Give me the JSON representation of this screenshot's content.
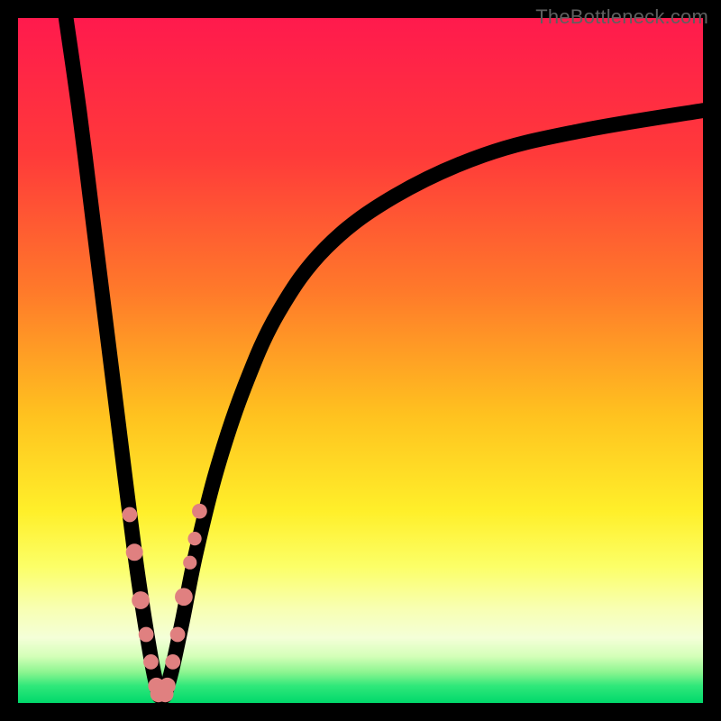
{
  "watermark": "TheBottleneck.com",
  "chart_data": {
    "type": "line",
    "title": "",
    "xlabel": "",
    "ylabel": "",
    "xlim": [
      0,
      100
    ],
    "ylim": [
      0,
      100
    ],
    "gradient_stops": [
      {
        "offset": 0.0,
        "color": "#ff1a4d"
      },
      {
        "offset": 0.2,
        "color": "#ff3a3a"
      },
      {
        "offset": 0.4,
        "color": "#ff7a2a"
      },
      {
        "offset": 0.58,
        "color": "#ffc21f"
      },
      {
        "offset": 0.72,
        "color": "#ffef2a"
      },
      {
        "offset": 0.8,
        "color": "#fcff66"
      },
      {
        "offset": 0.86,
        "color": "#f8ffb0"
      },
      {
        "offset": 0.905,
        "color": "#f4ffd8"
      },
      {
        "offset": 0.932,
        "color": "#d4ffb8"
      },
      {
        "offset": 0.955,
        "color": "#8cf590"
      },
      {
        "offset": 0.975,
        "color": "#30e87a"
      },
      {
        "offset": 1.0,
        "color": "#00d86b"
      }
    ],
    "series": [
      {
        "name": "left-branch",
        "x": [
          7.0,
          9.0,
          11.0,
          13.0,
          14.5,
          16.0,
          17.3,
          18.5,
          19.7,
          20.6
        ],
        "y": [
          100.0,
          86.0,
          70.0,
          54.0,
          42.0,
          30.0,
          20.0,
          12.0,
          5.0,
          1.0
        ]
      },
      {
        "name": "right-branch",
        "x": [
          21.4,
          22.5,
          24.0,
          26.0,
          29.0,
          33.0,
          38.0,
          45.0,
          55.0,
          68.0,
          82.0,
          100.0
        ],
        "y": [
          1.0,
          5.0,
          12.0,
          22.0,
          34.0,
          46.0,
          57.0,
          66.5,
          74.0,
          80.0,
          83.5,
          86.5
        ]
      }
    ],
    "beads_left": [
      {
        "x": 16.3,
        "y": 27.5,
        "r": 1.1
      },
      {
        "x": 17.0,
        "y": 22.0,
        "r": 1.25
      },
      {
        "x": 17.9,
        "y": 15.0,
        "r": 1.3
      },
      {
        "x": 18.7,
        "y": 10.0,
        "r": 1.1
      },
      {
        "x": 19.4,
        "y": 6.0,
        "r": 1.1
      },
      {
        "x": 20.2,
        "y": 2.5,
        "r": 1.2
      }
    ],
    "beads_right": [
      {
        "x": 21.8,
        "y": 2.5,
        "r": 1.2
      },
      {
        "x": 22.6,
        "y": 6.0,
        "r": 1.1
      },
      {
        "x": 23.3,
        "y": 10.0,
        "r": 1.1
      },
      {
        "x": 24.2,
        "y": 15.5,
        "r": 1.3
      },
      {
        "x": 25.1,
        "y": 20.5,
        "r": 1.0
      },
      {
        "x": 25.8,
        "y": 24.0,
        "r": 1.0
      },
      {
        "x": 26.5,
        "y": 28.0,
        "r": 1.1
      }
    ],
    "beads_bottom": [
      {
        "x": 20.5,
        "y": 1.3,
        "r": 1.2
      },
      {
        "x": 21.5,
        "y": 1.3,
        "r": 1.2
      }
    ]
  }
}
